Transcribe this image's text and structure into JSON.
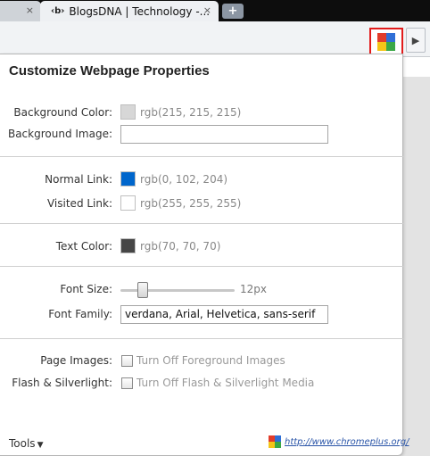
{
  "browser": {
    "tabs": [
      {
        "label": "",
        "close": "×"
      },
      {
        "favicon": "‹b›",
        "label": "BlogsDNA | Technology -...",
        "close": "×"
      }
    ],
    "new_tab": "+",
    "extension_icon": "colorful-puzzle-icon",
    "menu_arrow": "▶"
  },
  "panel": {
    "title": "Customize Webpage Properties",
    "background_color": {
      "label": "Background Color:",
      "value": "rgb(215, 215, 215)",
      "swatch": "#d7d7d7"
    },
    "background_image": {
      "label": "Background Image:",
      "value": ""
    },
    "normal_link": {
      "label": "Normal Link:",
      "value": "rgb(0, 102, 204)",
      "swatch": "#0066cc"
    },
    "visited_link": {
      "label": "Visited Link:",
      "value": "rgb(255, 255, 255)",
      "swatch": "#ffffff"
    },
    "text_color": {
      "label": "Text Color:",
      "value": "rgb(70, 70, 70)",
      "swatch": "#464646"
    },
    "font_size": {
      "label": "Font Size:",
      "value": "12px"
    },
    "font_family": {
      "label": "Font Family:",
      "value": "verdana, Arial, Helvetica, sans-serif"
    },
    "page_images": {
      "label": "Page Images:",
      "option": "Turn Off Foreground Images",
      "checked": false
    },
    "flash": {
      "label": "Flash & Silverlight:",
      "option": "Turn Off Flash & Silverlight Media",
      "checked": false
    },
    "tools": {
      "label": "Tools",
      "caret": "▼"
    },
    "link": "http://www.chromeplus.org/"
  },
  "colors": {
    "highlight": "#e21b1b",
    "link": "#2a55a8"
  }
}
